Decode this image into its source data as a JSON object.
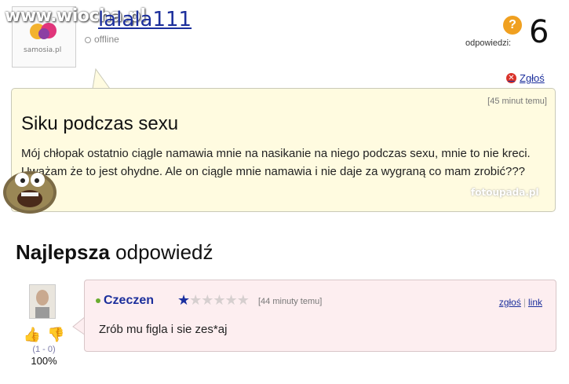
{
  "header": {
    "watermark": "www.wiocha.pl",
    "avatar_logo_text": "samosia.pl",
    "username": "lalala111",
    "status": "offline",
    "answers_label": "odpowiedzi:",
    "answers_count": "6",
    "report_label": "Zgłoś"
  },
  "question": {
    "time": "[45 minut temu]",
    "title": "Siku podczas sexu",
    "body": "Mój chłopak ostatnio ciągle namawia mnie na nasikanie na niego podczas sexu, mnie to nie kreci. Uważam że to jest ohydne. Ale on ciągle mnie namawia i nie daje za wygraną co mam zrobić???",
    "watermark_right": "fotoupada.pl"
  },
  "best_answer": {
    "heading_bold": "Najlepsza",
    "heading_rest": " odpowiedź",
    "user": "Czeczen",
    "stars_on": "★",
    "stars_off": "★★★★★",
    "time": "[44 minuty temu]",
    "report_link": "zgłoś",
    "link_label": "link",
    "text": "Zrób mu figla i sie zes*aj",
    "votes": "(1 - 0)",
    "percent": "100%"
  },
  "colors": {
    "link": "#1c2f9c",
    "question_bg": "#fffbe0",
    "answer_bg": "#fdeef0",
    "report_icon": "#d9332a"
  }
}
